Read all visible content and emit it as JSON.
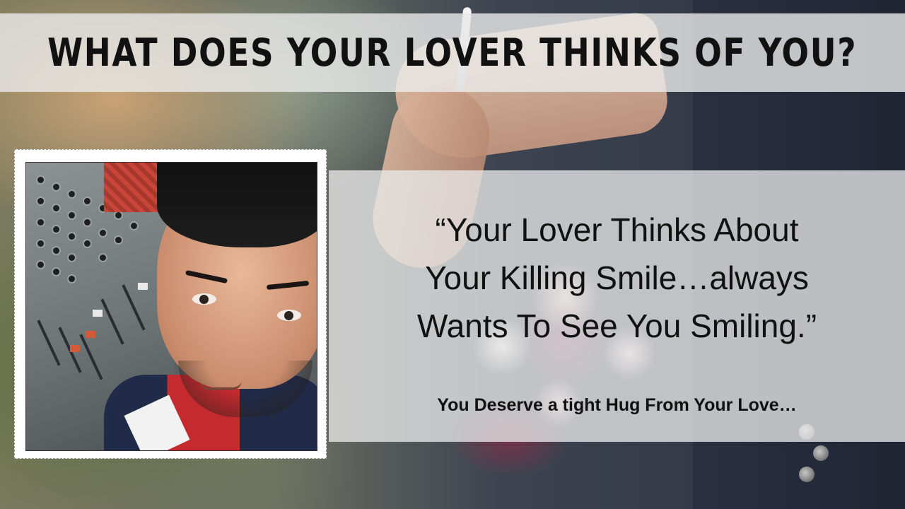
{
  "banner": {
    "title": "WHAT DOES YOUR LOVER THINKS OF YOU?"
  },
  "quote": {
    "line1": "“Your Lover Thinks About",
    "line2": "Your Killing Smile…always",
    "line3": "Wants To See You Smiling.”",
    "subtitle": "You Deserve a tight Hug From Your Love…"
  },
  "colors": {
    "banner_bg": "#ebebeb",
    "text": "#111111",
    "photo_frame": "#ffffff"
  }
}
